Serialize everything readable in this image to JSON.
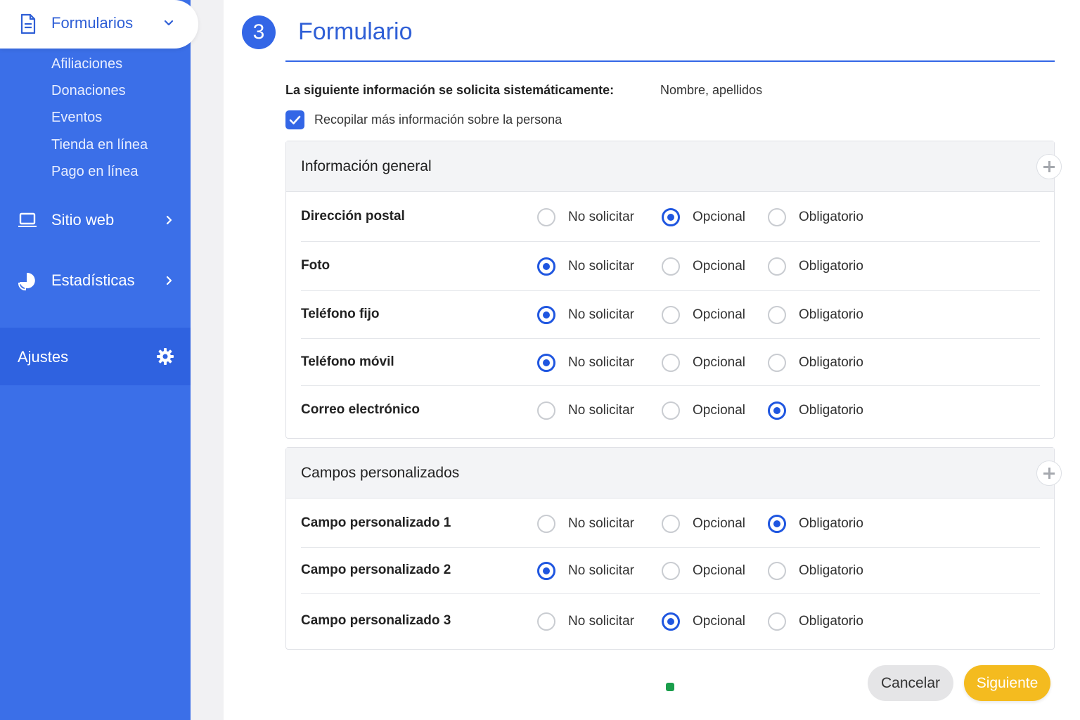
{
  "sidebar": {
    "active": {
      "label": "Formularios",
      "icon": "document-icon"
    },
    "subitems": [
      "Afiliaciones",
      "Donaciones",
      "Eventos",
      "Tienda en línea",
      "Pago en línea"
    ],
    "nav": [
      {
        "label": "Sitio web",
        "icon": "laptop-icon"
      },
      {
        "label": "Estadísticas",
        "icon": "pie-chart-icon"
      }
    ],
    "settings": {
      "label": "Ajustes",
      "icon": "gear-icon"
    },
    "colors": {
      "background": "#3b6fe8",
      "settings_bg": "#2f62e0",
      "active_text": "#2f5fd6"
    }
  },
  "main": {
    "step_number": "3",
    "title": "Formulario",
    "info_label": "La siguiente información se solicita sistemáticamente:",
    "info_value": "Nombre, apellidos",
    "collect_more": {
      "label": "Recopilar más información sobre la persona",
      "checked": true
    },
    "options": [
      "No solicitar",
      "Opcional",
      "Obligatorio"
    ],
    "sections": [
      {
        "title": "Información general",
        "rows": [
          {
            "label": "Dirección postal",
            "selected": "Opcional"
          },
          {
            "label": "Foto",
            "selected": "No solicitar"
          },
          {
            "label": "Teléfono fijo",
            "selected": "No solicitar"
          },
          {
            "label": "Teléfono móvil",
            "selected": "No solicitar"
          },
          {
            "label": "Correo electrónico",
            "selected": "Obligatorio"
          }
        ]
      },
      {
        "title": "Campos personalizados",
        "rows": [
          {
            "label": "Campo personalizado 1",
            "selected": "Obligatorio"
          },
          {
            "label": "Campo personalizado 2",
            "selected": "No solicitar"
          },
          {
            "label": "Campo personalizado 3",
            "selected": "Opcional"
          }
        ]
      }
    ],
    "buttons": {
      "cancel": "Cancelar",
      "next": "Siguiente"
    },
    "colors": {
      "accent": "#3366e6",
      "next_button": "#f4bb1f",
      "status_dot": "#1a9e4b"
    }
  }
}
